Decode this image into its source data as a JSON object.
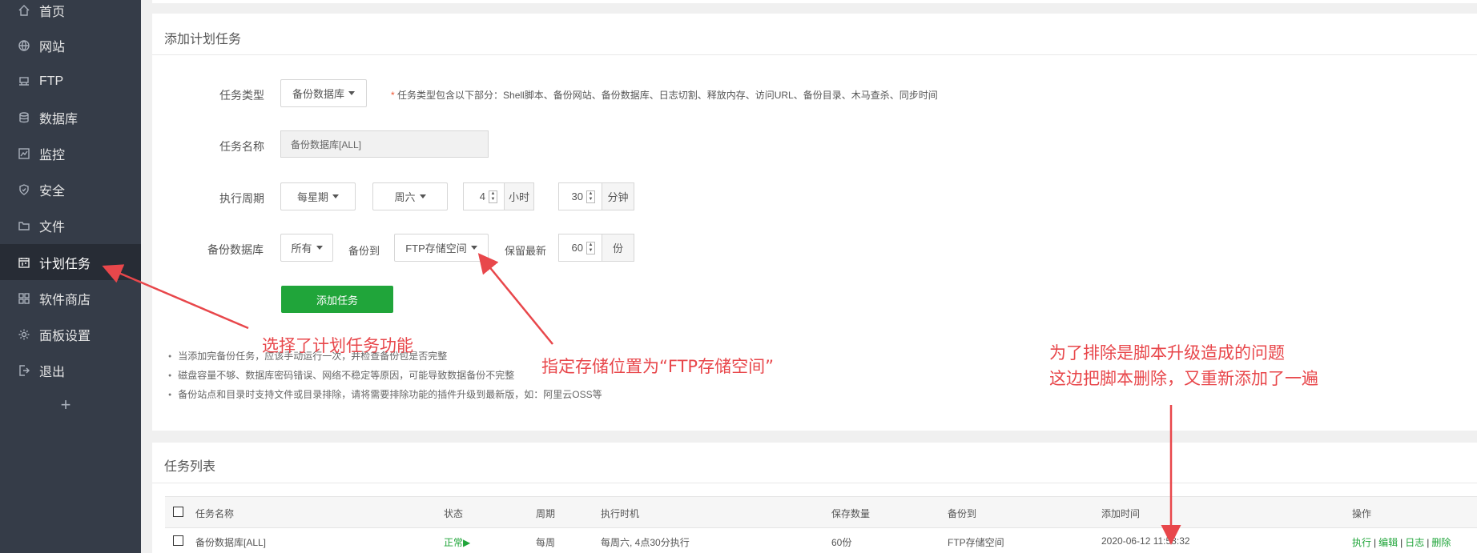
{
  "sidebar": {
    "items": [
      {
        "label": "首页",
        "icon": "home-icon"
      },
      {
        "label": "网站",
        "icon": "globe-icon"
      },
      {
        "label": "FTP",
        "icon": "ftp-icon"
      },
      {
        "label": "数据库",
        "icon": "database-icon"
      },
      {
        "label": "监控",
        "icon": "monitor-icon"
      },
      {
        "label": "安全",
        "icon": "shield-icon"
      },
      {
        "label": "文件",
        "icon": "folder-icon"
      },
      {
        "label": "计划任务",
        "icon": "calendar-icon"
      },
      {
        "label": "软件商店",
        "icon": "grid-icon"
      },
      {
        "label": "面板设置",
        "icon": "gear-icon"
      },
      {
        "label": "退出",
        "icon": "logout-icon"
      }
    ],
    "active_item": "计划任务",
    "add_label": "+"
  },
  "add_task": {
    "title": "添加计划任务",
    "task_type_label": "任务类型",
    "task_type_value": "备份数据库",
    "task_type_hint_star": "*",
    "task_type_hint": "任务类型包含以下部分：Shell脚本、备份网站、备份数据库、日志切割、释放内存、访问URL、备份目录、木马查杀、同步时间",
    "task_name_label": "任务名称",
    "task_name_value": "备份数据库[ALL]",
    "period_label": "执行周期",
    "period_value": "每星期",
    "weekday_value": "周六",
    "hour_value": "4",
    "hour_unit": "小时",
    "minute_value": "30",
    "minute_unit": "分钟",
    "backup_db_label": "备份数据库",
    "backup_db_value": "所有",
    "backup_to_label": "备份到",
    "backup_to_value": "FTP存储空间",
    "keep_label": "保留最新",
    "keep_value": "60",
    "keep_unit": "份",
    "submit_label": "添加任务",
    "tips": [
      "当添加完备份任务，应该手动运行一次，并检查备份包是否完整",
      "磁盘容量不够、数据库密码错误、网络不稳定等原因，可能导致数据备份不完整",
      "备份站点和目录时支持文件或目录排除，请将需要排除功能的插件升级到最新版，如：阿里云OSS等"
    ]
  },
  "task_list": {
    "title": "任务列表",
    "columns": [
      "任务名称",
      "状态",
      "周期",
      "执行时机",
      "保存数量",
      "备份到",
      "添加时间",
      "操作"
    ],
    "rows": [
      {
        "name": "备份数据库[ALL]",
        "status": "正常▶",
        "period": "每周",
        "timing": "每周六, 4点30分执行",
        "keep": "60份",
        "backup_to": "FTP存储空间",
        "added": "2020-06-12 11:58:32",
        "ops": [
          "执行",
          "编辑",
          "日志",
          "删除"
        ]
      }
    ]
  },
  "annotations": {
    "sidebar_note": "选择了计划任务功能",
    "storage_note": "指定存储位置为“FTP存储空间”",
    "reason_line1": "为了排除是脚本升级造成的问题",
    "reason_line2": "这边把脚本删除，又重新添加了一遍"
  },
  "colors": {
    "sidebar_bg": "#353c48",
    "active_bg": "#272c35",
    "accent_green": "#20a53a",
    "annotation_red": "#e8474b"
  }
}
